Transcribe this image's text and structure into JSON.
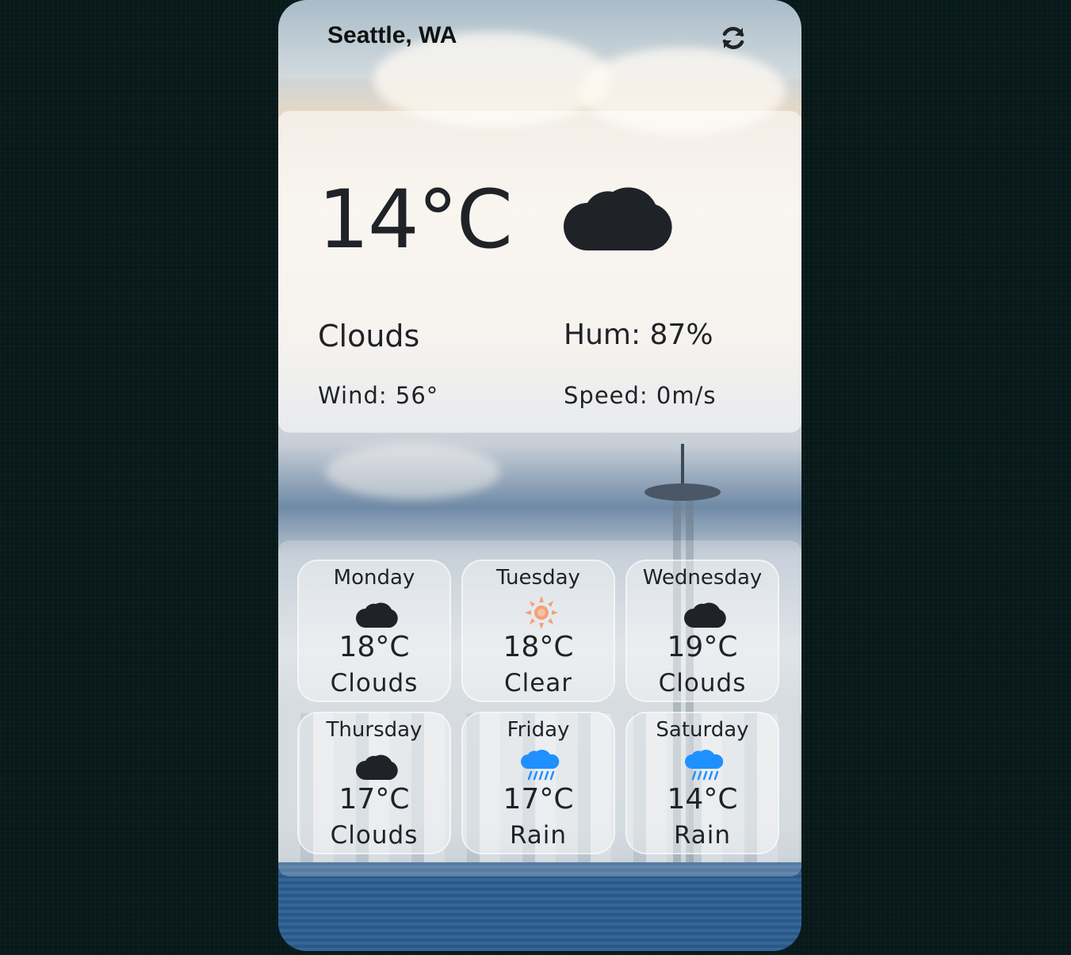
{
  "location": "Seattle, WA",
  "current": {
    "temperature": "14°C",
    "icon": "cloud-icon",
    "description": "Clouds",
    "humidity": "Hum: 87%",
    "wind": "Wind: 56°",
    "speed": "Speed: 0m/s"
  },
  "forecast": [
    {
      "day": "Monday",
      "temp": "18°C",
      "desc": "Clouds",
      "icon": "cloud-icon"
    },
    {
      "day": "Tuesday",
      "temp": "18°C",
      "desc": "Clear",
      "icon": "sun-icon"
    },
    {
      "day": "Wednesday",
      "temp": "19°C",
      "desc": "Clouds",
      "icon": "cloud-icon"
    },
    {
      "day": "Thursday",
      "temp": "17°C",
      "desc": "Clouds",
      "icon": "cloud-icon"
    },
    {
      "day": "Friday",
      "temp": "17°C",
      "desc": "Rain",
      "icon": "rain-icon"
    },
    {
      "day": "Saturday",
      "temp": "14°C",
      "desc": "Rain",
      "icon": "rain-icon"
    }
  ],
  "colors": {
    "text": "#1f2328",
    "sun": "#f4a07a",
    "rain": "#1e90ff",
    "page_background": "#08191a"
  }
}
